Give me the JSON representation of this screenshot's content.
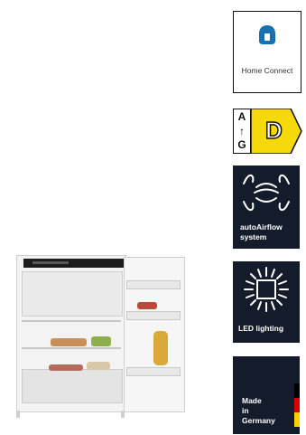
{
  "product": {
    "name": "built-in fridge-freezer"
  },
  "badges": {
    "home_connect": {
      "label": "Home Connect",
      "icon": "home-connect-icon",
      "color": "#1a6fb0"
    },
    "energy_label": {
      "scale_top": "A",
      "scale_arrow": "↑",
      "scale_bottom": "G",
      "class": "D",
      "color": "#f5d90a"
    },
    "airflow": {
      "line1": "autoAirflow",
      "line2": "system",
      "icon": "airflow-icon"
    },
    "led": {
      "label": "LED lighting",
      "icon": "led-icon"
    },
    "made_in": {
      "line1": "Made",
      "line2": "in",
      "line3": "Germany",
      "flag_colors": [
        "#000000",
        "#dd0000",
        "#ffce00"
      ]
    }
  },
  "theme": {
    "badge_dark": "#141c2c"
  }
}
